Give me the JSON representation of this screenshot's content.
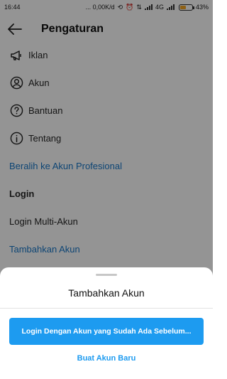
{
  "status_bar": {
    "time": "16:44",
    "network_speed": "... 0,00K/d",
    "network_type": "4G",
    "battery": "43%",
    "battery_level": 0.43
  },
  "header": {
    "title": "Pengaturan"
  },
  "menu": {
    "items": [
      {
        "label": "Iklan",
        "icon": "megaphone-icon"
      },
      {
        "label": "Akun",
        "icon": "user-circle-icon"
      },
      {
        "label": "Bantuan",
        "icon": "help-circle-icon"
      },
      {
        "label": "Tentang",
        "icon": "info-circle-icon"
      }
    ],
    "switch_professional": "Beralih ke Akun Profesional",
    "login_section": "Login",
    "multi_account": "Login Multi-Akun",
    "add_account": "Tambahkan Akun"
  },
  "sheet": {
    "title": "Tambahkan Akun",
    "primary_button": "Login Dengan Akun yang Sudah Ada Sebelum...",
    "secondary_button": "Buat Akun Baru"
  },
  "colors": {
    "link": "#1877c9",
    "primary": "#1d9bf0",
    "battery": "#f5a623"
  }
}
